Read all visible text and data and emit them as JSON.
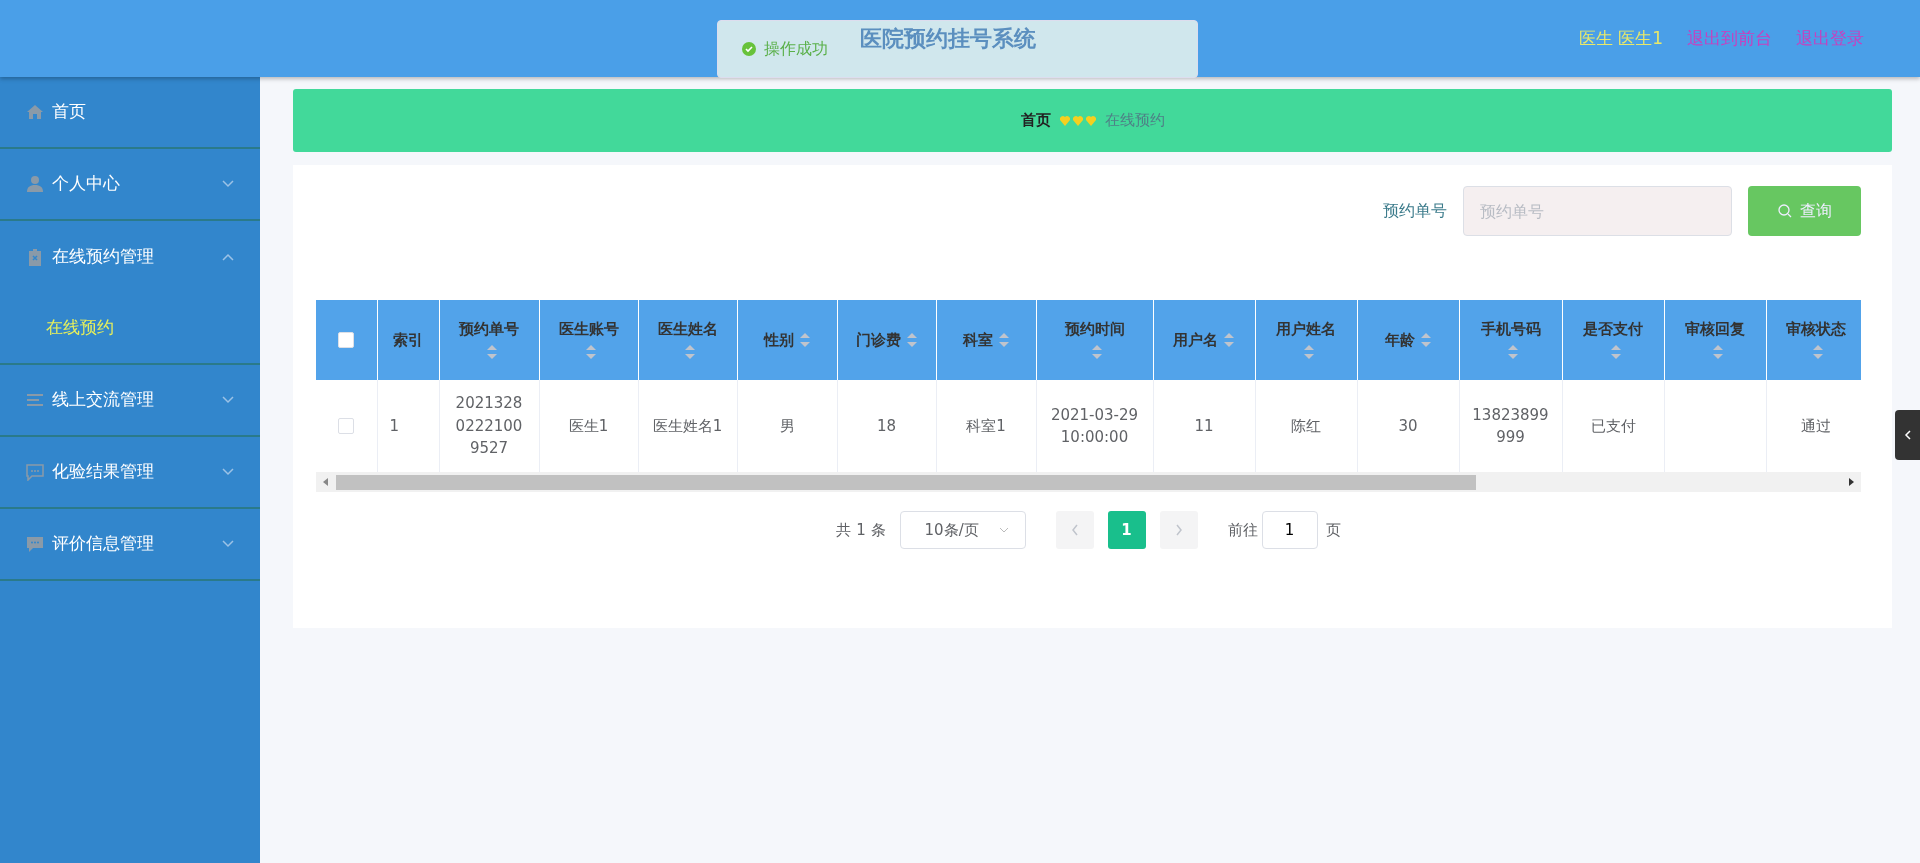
{
  "header": {
    "title": "医院预约挂号系统",
    "user": "医生 医生1",
    "links": [
      "退出到前台",
      "退出登录"
    ]
  },
  "toast": {
    "message": "操作成功"
  },
  "sidebar": {
    "items": [
      {
        "label": "首页"
      },
      {
        "label": "个人中心",
        "expanded": false
      },
      {
        "label": "在线预约管理",
        "expanded": true,
        "children": [
          {
            "label": "在线预约",
            "selected": true
          }
        ]
      },
      {
        "label": "线上交流管理",
        "expanded": false
      },
      {
        "label": "化验结果管理",
        "expanded": false
      },
      {
        "label": "评价信息管理",
        "expanded": false
      }
    ]
  },
  "breadcrumb": {
    "items": [
      "首页",
      "在线预约"
    ]
  },
  "search": {
    "label": "预约单号",
    "placeholder": "预约单号",
    "button": "查询"
  },
  "table": {
    "header_checked": false,
    "columns": [
      {
        "label": "索引",
        "sortable": false
      },
      {
        "label": "预约单号",
        "sortable": true
      },
      {
        "label": "医生账号",
        "sortable": true
      },
      {
        "label": "医生姓名",
        "sortable": true
      },
      {
        "label": "性别",
        "sortable": true
      },
      {
        "label": "门诊费",
        "sortable": true
      },
      {
        "label": "科室",
        "sortable": true
      },
      {
        "label": "预约时间",
        "sortable": true
      },
      {
        "label": "用户名",
        "sortable": true
      },
      {
        "label": "用户姓名",
        "sortable": true
      },
      {
        "label": "年龄",
        "sortable": true
      },
      {
        "label": "手机号码",
        "sortable": true
      },
      {
        "label": "是否支付",
        "sortable": true
      },
      {
        "label": "审核回复",
        "sortable": true
      },
      {
        "label": "审核状态",
        "sortable": true
      }
    ],
    "rows": [
      {
        "checked": false,
        "cells": [
          "1",
          "202132802221009527",
          "医生1",
          "医生姓名1",
          "男",
          "18",
          "科室1",
          "2021-03-29 10:00:00",
          "11",
          "陈红",
          "30",
          "13823899999",
          "已支付",
          null,
          "通过"
        ]
      }
    ]
  },
  "pagination": {
    "total": "共 1 条",
    "page_size": "10条/页",
    "pages": [
      {
        "label": "1",
        "selected": true
      }
    ],
    "goto_label": "前往",
    "goto_value": "1",
    "goto_suffix": "页"
  }
}
